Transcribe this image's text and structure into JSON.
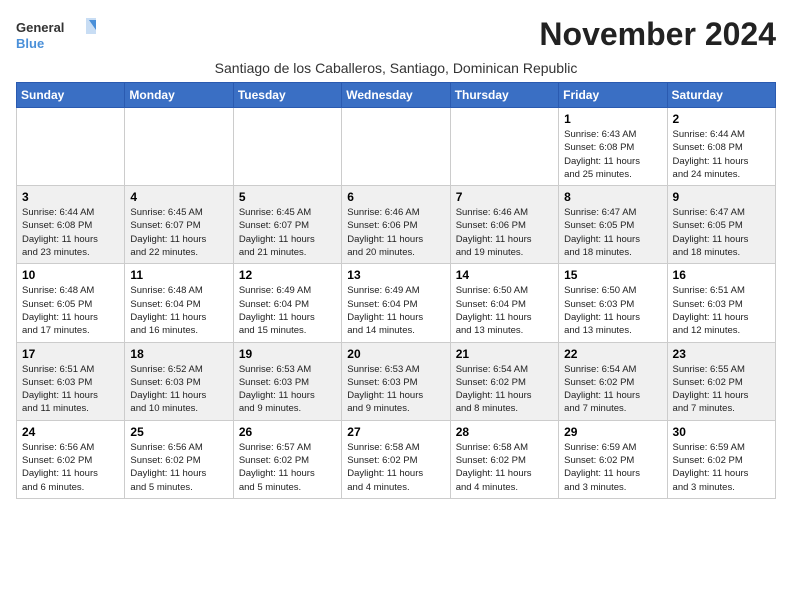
{
  "logo": {
    "line1": "General",
    "line2": "Blue"
  },
  "title": "November 2024",
  "subtitle": "Santiago de los Caballeros, Santiago, Dominican Republic",
  "days_of_week": [
    "Sunday",
    "Monday",
    "Tuesday",
    "Wednesday",
    "Thursday",
    "Friday",
    "Saturday"
  ],
  "weeks": [
    [
      {
        "day": "",
        "info": ""
      },
      {
        "day": "",
        "info": ""
      },
      {
        "day": "",
        "info": ""
      },
      {
        "day": "",
        "info": ""
      },
      {
        "day": "",
        "info": ""
      },
      {
        "day": "1",
        "info": "Sunrise: 6:43 AM\nSunset: 6:08 PM\nDaylight: 11 hours\nand 25 minutes."
      },
      {
        "day": "2",
        "info": "Sunrise: 6:44 AM\nSunset: 6:08 PM\nDaylight: 11 hours\nand 24 minutes."
      }
    ],
    [
      {
        "day": "3",
        "info": "Sunrise: 6:44 AM\nSunset: 6:08 PM\nDaylight: 11 hours\nand 23 minutes."
      },
      {
        "day": "4",
        "info": "Sunrise: 6:45 AM\nSunset: 6:07 PM\nDaylight: 11 hours\nand 22 minutes."
      },
      {
        "day": "5",
        "info": "Sunrise: 6:45 AM\nSunset: 6:07 PM\nDaylight: 11 hours\nand 21 minutes."
      },
      {
        "day": "6",
        "info": "Sunrise: 6:46 AM\nSunset: 6:06 PM\nDaylight: 11 hours\nand 20 minutes."
      },
      {
        "day": "7",
        "info": "Sunrise: 6:46 AM\nSunset: 6:06 PM\nDaylight: 11 hours\nand 19 minutes."
      },
      {
        "day": "8",
        "info": "Sunrise: 6:47 AM\nSunset: 6:05 PM\nDaylight: 11 hours\nand 18 minutes."
      },
      {
        "day": "9",
        "info": "Sunrise: 6:47 AM\nSunset: 6:05 PM\nDaylight: 11 hours\nand 18 minutes."
      }
    ],
    [
      {
        "day": "10",
        "info": "Sunrise: 6:48 AM\nSunset: 6:05 PM\nDaylight: 11 hours\nand 17 minutes."
      },
      {
        "day": "11",
        "info": "Sunrise: 6:48 AM\nSunset: 6:04 PM\nDaylight: 11 hours\nand 16 minutes."
      },
      {
        "day": "12",
        "info": "Sunrise: 6:49 AM\nSunset: 6:04 PM\nDaylight: 11 hours\nand 15 minutes."
      },
      {
        "day": "13",
        "info": "Sunrise: 6:49 AM\nSunset: 6:04 PM\nDaylight: 11 hours\nand 14 minutes."
      },
      {
        "day": "14",
        "info": "Sunrise: 6:50 AM\nSunset: 6:04 PM\nDaylight: 11 hours\nand 13 minutes."
      },
      {
        "day": "15",
        "info": "Sunrise: 6:50 AM\nSunset: 6:03 PM\nDaylight: 11 hours\nand 13 minutes."
      },
      {
        "day": "16",
        "info": "Sunrise: 6:51 AM\nSunset: 6:03 PM\nDaylight: 11 hours\nand 12 minutes."
      }
    ],
    [
      {
        "day": "17",
        "info": "Sunrise: 6:51 AM\nSunset: 6:03 PM\nDaylight: 11 hours\nand 11 minutes."
      },
      {
        "day": "18",
        "info": "Sunrise: 6:52 AM\nSunset: 6:03 PM\nDaylight: 11 hours\nand 10 minutes."
      },
      {
        "day": "19",
        "info": "Sunrise: 6:53 AM\nSunset: 6:03 PM\nDaylight: 11 hours\nand 9 minutes."
      },
      {
        "day": "20",
        "info": "Sunrise: 6:53 AM\nSunset: 6:03 PM\nDaylight: 11 hours\nand 9 minutes."
      },
      {
        "day": "21",
        "info": "Sunrise: 6:54 AM\nSunset: 6:02 PM\nDaylight: 11 hours\nand 8 minutes."
      },
      {
        "day": "22",
        "info": "Sunrise: 6:54 AM\nSunset: 6:02 PM\nDaylight: 11 hours\nand 7 minutes."
      },
      {
        "day": "23",
        "info": "Sunrise: 6:55 AM\nSunset: 6:02 PM\nDaylight: 11 hours\nand 7 minutes."
      }
    ],
    [
      {
        "day": "24",
        "info": "Sunrise: 6:56 AM\nSunset: 6:02 PM\nDaylight: 11 hours\nand 6 minutes."
      },
      {
        "day": "25",
        "info": "Sunrise: 6:56 AM\nSunset: 6:02 PM\nDaylight: 11 hours\nand 5 minutes."
      },
      {
        "day": "26",
        "info": "Sunrise: 6:57 AM\nSunset: 6:02 PM\nDaylight: 11 hours\nand 5 minutes."
      },
      {
        "day": "27",
        "info": "Sunrise: 6:58 AM\nSunset: 6:02 PM\nDaylight: 11 hours\nand 4 minutes."
      },
      {
        "day": "28",
        "info": "Sunrise: 6:58 AM\nSunset: 6:02 PM\nDaylight: 11 hours\nand 4 minutes."
      },
      {
        "day": "29",
        "info": "Sunrise: 6:59 AM\nSunset: 6:02 PM\nDaylight: 11 hours\nand 3 minutes."
      },
      {
        "day": "30",
        "info": "Sunrise: 6:59 AM\nSunset: 6:02 PM\nDaylight: 11 hours\nand 3 minutes."
      }
    ]
  ]
}
